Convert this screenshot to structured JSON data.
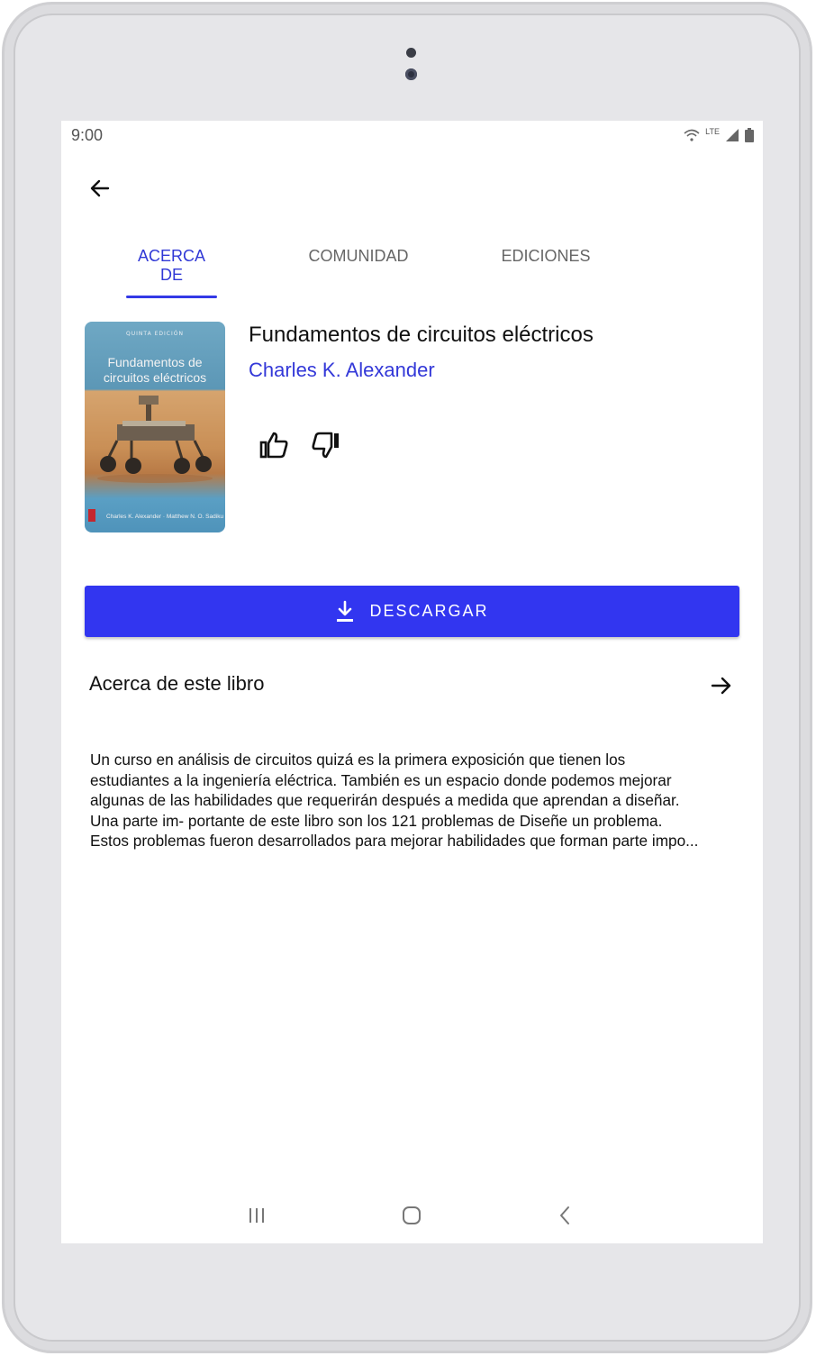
{
  "status_bar": {
    "time": "9:00",
    "network_label": "LTE",
    "icons": [
      "wifi-icon",
      "signal-icon",
      "battery-icon"
    ]
  },
  "toolbar": {
    "back_icon": "arrow-left-icon"
  },
  "tabs": [
    {
      "label": "ACERCA DE",
      "active": true
    },
    {
      "label": "COMUNIDAD",
      "active": false
    },
    {
      "label": "EDICIONES",
      "active": false
    }
  ],
  "book": {
    "title": "Fundamentos de circuitos eléctricos",
    "author": "Charles K. Alexander",
    "cover": {
      "edition": "QUINTA EDICIÓN",
      "title_line1": "Fundamentos de",
      "title_line2": "circuitos eléctricos",
      "authors": "Charles K. Alexander · Matthew N. O. Sadiku"
    }
  },
  "actions": {
    "like_icon": "thumb-up-icon",
    "dislike_icon": "thumb-down-icon",
    "download_label": "DESCARGAR",
    "download_icon": "download-icon"
  },
  "about": {
    "heading": "Acerca de este libro",
    "arrow_icon": "arrow-right-icon",
    "description": " Un curso en análisis de circuitos quizá es la primera exposición que tienen los\nestudiantes a la ingeniería eléctrica. También es un espacio donde podemos mejorar\nalgunas de las habilidades que requerirán después a medida que aprendan a diseñar.\nUna parte im- portante de este libro son los 121 problemas de Diseñe un problema.\nEstos problemas fueron desarrollados para mejorar habilidades que forman parte impo..."
  },
  "nav_bar": [
    "recents-icon",
    "home-icon",
    "back-icon"
  ],
  "colors": {
    "accent": "#3236f0",
    "tab_active": "#3038d6",
    "author": "#3338d8"
  }
}
